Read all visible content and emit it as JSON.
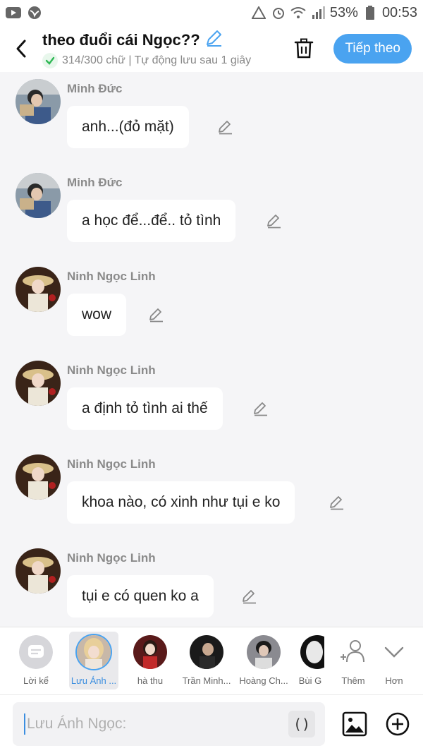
{
  "status_bar": {
    "battery": "53%",
    "time": "00:53",
    "icons": [
      "youtube-icon",
      "browser-icon",
      "recycle-icon",
      "alarm-icon",
      "wifi-icon",
      "signal-icon",
      "battery-icon"
    ]
  },
  "header": {
    "title": "theo đuổi cái Ngọc??",
    "subtitle": "314/300 chữ | Tự động lưu sau 1 giây",
    "next_label": "Tiếp theo"
  },
  "messages": [
    {
      "name": "Minh Đức",
      "text": "anh...(đỏ mặt)",
      "avatar": "minh-duc"
    },
    {
      "name": "Minh Đức",
      "text": "a học để...để.. tỏ tình",
      "avatar": "minh-duc"
    },
    {
      "name": "Ninh Ngọc Linh",
      "text": "wow",
      "avatar": "ninh-ngoc-linh"
    },
    {
      "name": "Ninh Ngọc Linh",
      "text": "a định tỏ tình ai thế",
      "avatar": "ninh-ngoc-linh"
    },
    {
      "name": "Ninh Ngọc Linh",
      "text": "khoa nào, có xinh như tụi e ko",
      "avatar": "ninh-ngoc-linh"
    },
    {
      "name": "Ninh Ngọc Linh",
      "text": "tụi e có quen ko a",
      "avatar": "ninh-ngoc-linh"
    }
  ],
  "characters": [
    {
      "label": "Lời kể"
    },
    {
      "label": "Lưu Ánh ..."
    },
    {
      "label": "hà thu"
    },
    {
      "label": "Trần Minh..."
    },
    {
      "label": "Hoàng Ch..."
    },
    {
      "label": "Bùi G"
    },
    {
      "label": "Thêm"
    },
    {
      "label": "Hơn"
    }
  ],
  "input": {
    "placeholder": "Lưu Ánh Ngọc:",
    "paren_label": "()"
  },
  "colors": {
    "accent": "#4aa3f0",
    "background": "#f5f5f7",
    "bubble": "#ffffff",
    "check_green": "#2fb855"
  }
}
